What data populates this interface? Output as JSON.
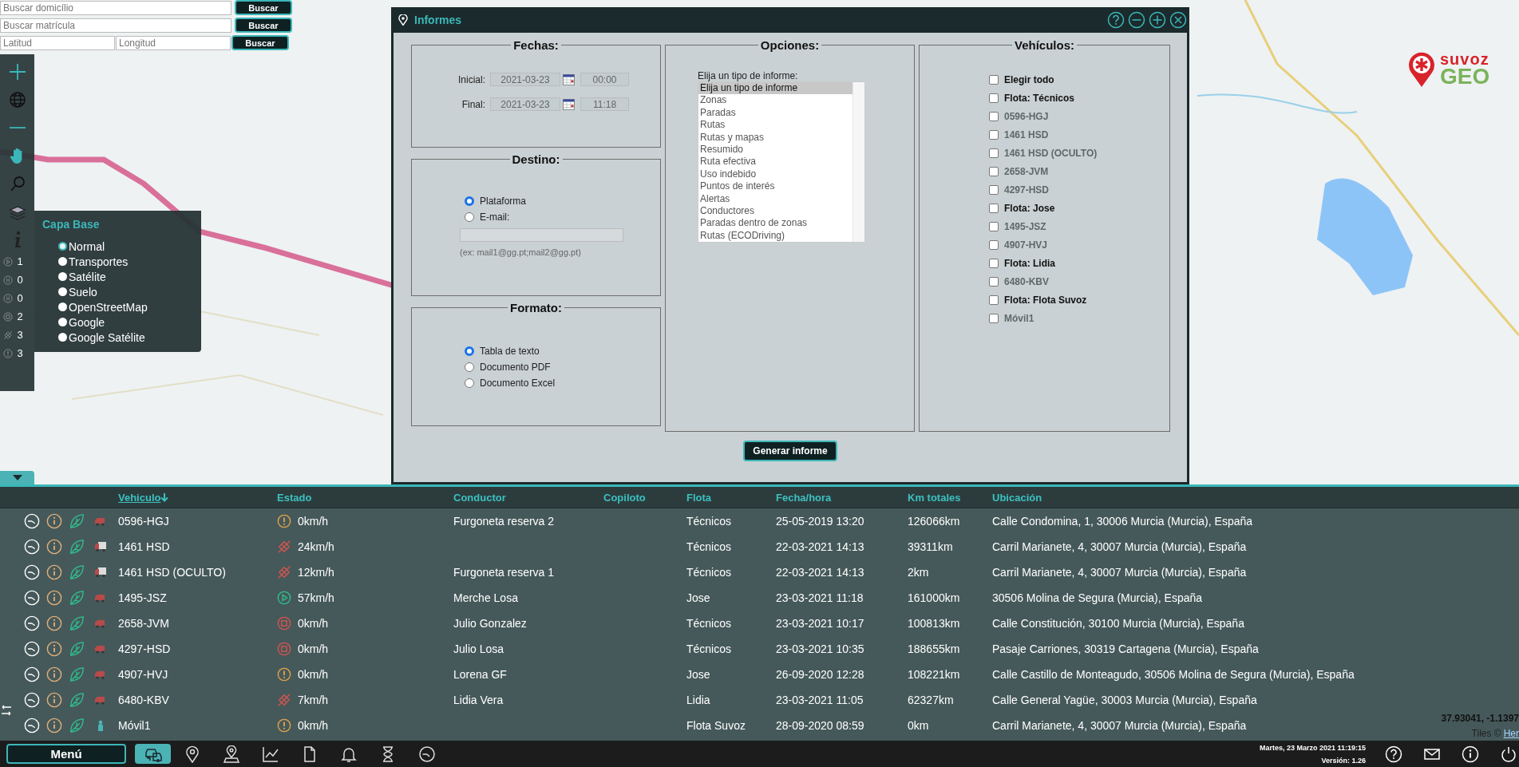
{
  "search": [
    {
      "fields": [
        {
          "placeholder": "Buscar domicílio"
        }
      ],
      "button": "Buscar"
    },
    {
      "fields": [
        {
          "placeholder": "Buscar matrícula"
        }
      ],
      "button": "Buscar"
    },
    {
      "fields": [
        {
          "placeholder": "Latitud"
        },
        {
          "placeholder": "Longitud"
        }
      ],
      "button": "Buscar"
    }
  ],
  "counters": [
    {
      "kind": "moving",
      "count": "1"
    },
    {
      "kind": "paused",
      "count": "0"
    },
    {
      "kind": "idle",
      "count": "0"
    },
    {
      "kind": "stopped",
      "count": "2"
    },
    {
      "kind": "no_signal",
      "count": "3"
    },
    {
      "kind": "alert",
      "count": "3"
    }
  ],
  "base_layer": {
    "title": "Capa Base",
    "options": [
      {
        "label": "Normal",
        "selected": true
      },
      {
        "label": "Transportes",
        "selected": false
      },
      {
        "label": "Satélite",
        "selected": false
      },
      {
        "label": "Suelo",
        "selected": false
      },
      {
        "label": "OpenStreetMap",
        "selected": false
      },
      {
        "label": "Google",
        "selected": false
      },
      {
        "label": "Google Satélite",
        "selected": false
      }
    ]
  },
  "logo": {
    "word1": "suvoz",
    "word2": "GEO"
  },
  "dialog": {
    "title": "Informes",
    "fechas": {
      "legend": "Fechas:",
      "rows": [
        {
          "label": "Inicial:",
          "date": "2021-03-23",
          "time": "00:00"
        },
        {
          "label": "Final:",
          "date": "2021-03-23",
          "time": "11:18"
        }
      ]
    },
    "destino": {
      "legend": "Destino:",
      "options": [
        {
          "label": "Plataforma",
          "selected": true
        },
        {
          "label": "E-mail:",
          "selected": false
        }
      ],
      "email_disabled": true,
      "hint": "(ex: mail1@gg.pt;mail2@gg.pt)"
    },
    "formato": {
      "legend": "Formato:",
      "options": [
        {
          "label": "Tabla de texto",
          "selected": true
        },
        {
          "label": "Documento PDF",
          "selected": false
        },
        {
          "label": "Documento Excel",
          "selected": false
        }
      ]
    },
    "opciones": {
      "legend": "Opciones:",
      "prompt": "Elija un tipo de informe:",
      "items": [
        {
          "label": "Elija un tipo de informe",
          "selected": true
        },
        {
          "label": "Zonas",
          "selected": false
        },
        {
          "label": "Paradas",
          "selected": false
        },
        {
          "label": "Rutas",
          "selected": false
        },
        {
          "label": "Rutas y mapas",
          "selected": false
        },
        {
          "label": "Resumido",
          "selected": false
        },
        {
          "label": "Ruta efectiva",
          "selected": false
        },
        {
          "label": "Uso indebido",
          "selected": false
        },
        {
          "label": "Puntos de interés",
          "selected": false
        },
        {
          "label": "Alertas",
          "selected": false
        },
        {
          "label": "Conductores",
          "selected": false
        },
        {
          "label": "Paradas dentro de zonas",
          "selected": false
        },
        {
          "label": "Rutas (ECODriving)",
          "selected": false
        }
      ]
    },
    "vehiculos": {
      "legend": "Vehículos:",
      "items": [
        {
          "label": "Elegir todo",
          "kind": "group",
          "checked": false
        },
        {
          "label": "Flota: Técnicos",
          "kind": "group",
          "checked": false
        },
        {
          "label": "0596-HGJ",
          "kind": "vehicle",
          "checked": false
        },
        {
          "label": "1461 HSD",
          "kind": "vehicle",
          "checked": false
        },
        {
          "label": "1461 HSD (OCULTO)",
          "kind": "vehicle",
          "checked": false
        },
        {
          "label": "2658-JVM",
          "kind": "vehicle",
          "checked": false
        },
        {
          "label": "4297-HSD",
          "kind": "vehicle",
          "checked": false
        },
        {
          "label": "Flota: Jose",
          "kind": "group",
          "checked": false
        },
        {
          "label": "1495-JSZ",
          "kind": "vehicle",
          "checked": false
        },
        {
          "label": "4907-HVJ",
          "kind": "vehicle",
          "checked": false
        },
        {
          "label": "Flota: Lidia",
          "kind": "group",
          "checked": false
        },
        {
          "label": "6480-KBV",
          "kind": "vehicle",
          "checked": false
        },
        {
          "label": "Flota: Flota Suvoz",
          "kind": "group",
          "checked": false
        },
        {
          "label": "Móvil1",
          "kind": "vehicle",
          "checked": false
        }
      ]
    },
    "button": "Generar informe"
  },
  "table": {
    "columns": [
      {
        "label": "Vehiculo",
        "sorted": true
      },
      {
        "label": "Estado",
        "sorted": false
      },
      {
        "label": "Conductor",
        "sorted": false
      },
      {
        "label": "Copiloto",
        "sorted": false
      },
      {
        "label": "Flota",
        "sorted": false
      },
      {
        "label": "Fecha/hora",
        "sorted": false
      },
      {
        "label": "Km totales",
        "sorted": false
      },
      {
        "label": "Ubicación",
        "sorted": false
      }
    ],
    "rows": [
      {
        "vehicle": {
          "kind": "van",
          "plate": "0596-HGJ"
        },
        "status": {
          "kind": "alert",
          "speed": "0km/h"
        },
        "driver": "Furgoneta reserva 2",
        "fleet": "Técnicos",
        "datetime": "25-05-2019 13:20",
        "km": "126066km",
        "location": "Calle Condomina, 1, 30006 Murcia (Murcia), España"
      },
      {
        "vehicle": {
          "kind": "truck",
          "plate": "1461 HSD"
        },
        "status": {
          "kind": "no_signal",
          "speed": "24km/h"
        },
        "fleet": "Técnicos",
        "datetime": "22-03-2021 14:13",
        "km": "39311km",
        "location": "Carril Marianete, 4, 30007 Murcia (Murcia), España"
      },
      {
        "vehicle": {
          "kind": "truck",
          "plate": "1461 HSD (OCULTO)"
        },
        "status": {
          "kind": "no_signal",
          "speed": "12km/h"
        },
        "driver": "Furgoneta reserva 1",
        "fleet": "Técnicos",
        "datetime": "22-03-2021 14:13",
        "km": "2km",
        "location": "Carril Marianete, 4, 30007 Murcia (Murcia), España"
      },
      {
        "vehicle": {
          "kind": "van",
          "plate": "1495-JSZ"
        },
        "status": {
          "kind": "moving",
          "speed": "57km/h"
        },
        "driver": "Merche Losa",
        "fleet": "Jose",
        "datetime": "23-03-2021 11:18",
        "km": "161000km",
        "location": "30506 Molina de Segura (Murcia), España"
      },
      {
        "vehicle": {
          "kind": "van",
          "plate": "2658-JVM"
        },
        "status": {
          "kind": "stopped",
          "speed": "0km/h"
        },
        "driver": "Julio Gonzalez",
        "fleet": "Técnicos",
        "datetime": "23-03-2021 10:17",
        "km": "100813km",
        "location": "Calle Constitución, 30100 Murcia (Murcia), España"
      },
      {
        "vehicle": {
          "kind": "van",
          "plate": "4297-HSD"
        },
        "status": {
          "kind": "stopped",
          "speed": "0km/h"
        },
        "driver": "Julio Losa",
        "fleet": "Técnicos",
        "datetime": "23-03-2021 10:35",
        "km": "188655km",
        "location": "Pasaje Carriones, 30319 Cartagena (Murcia), España"
      },
      {
        "vehicle": {
          "kind": "van",
          "plate": "4907-HVJ"
        },
        "status": {
          "kind": "alert",
          "speed": "0km/h"
        },
        "driver": "Lorena GF",
        "fleet": "Jose",
        "datetime": "26-09-2020 12:28",
        "km": "108221km",
        "location": "Calle Castillo de Monteagudo, 30506 Molina de Segura (Murcia), España"
      },
      {
        "vehicle": {
          "kind": "van",
          "plate": "6480-KBV"
        },
        "status": {
          "kind": "no_signal",
          "speed": "7km/h"
        },
        "driver": "Lidia Vera",
        "fleet": "Lidia",
        "datetime": "23-03-2021 11:05",
        "km": "62327km",
        "location": "Calle General Yagüe, 30003 Murcia (Murcia), España"
      },
      {
        "vehicle": {
          "kind": "person",
          "plate": "Móvil1"
        },
        "status": {
          "kind": "alert",
          "speed": "0km/h"
        },
        "fleet": "Flota Suvoz",
        "datetime": "28-09-2020 08:59",
        "km": "0km",
        "location": "Carril Marianete, 4, 30007 Murcia (Murcia), España"
      }
    ]
  },
  "map_overlay": {
    "coordinates": "37.93041, -1.1397",
    "tiles": "Tiles ©",
    "tiles_link": "Her"
  },
  "footer": {
    "menu": "Menú",
    "nav": [
      {
        "kind": "vehicles",
        "selected": true
      },
      {
        "kind": "pin",
        "selected": false
      },
      {
        "kind": "person_pin",
        "selected": false
      },
      {
        "kind": "chart",
        "selected": false
      },
      {
        "kind": "document",
        "selected": false
      },
      {
        "kind": "bell",
        "selected": false
      },
      {
        "kind": "hourglass",
        "selected": false
      },
      {
        "kind": "clock",
        "selected": false
      }
    ],
    "datetime": "Martes, 23 Marzo 2021 11:19:15",
    "version": "Versión: 1.26"
  }
}
